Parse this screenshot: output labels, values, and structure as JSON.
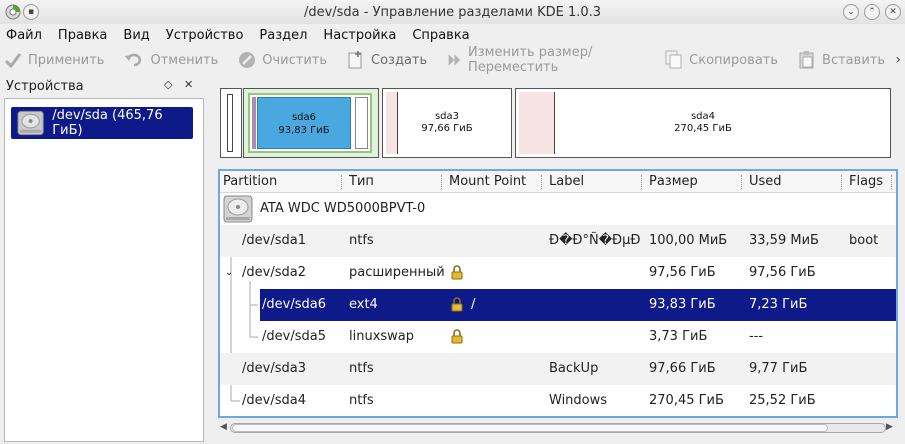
{
  "window": {
    "title": "/dev/sda - Управление разделами KDE 1.0.3"
  },
  "menu": [
    "Файл",
    "Правка",
    "Вид",
    "Устройство",
    "Раздел",
    "Настройка",
    "Справка"
  ],
  "toolbar": {
    "apply": "Применить",
    "undo": "Отменить",
    "clear": "Очистить",
    "create": "Создать",
    "resize": "Изменить размер/Переместить",
    "copy": "Скопировать",
    "paste": "Вставить",
    "more": "›"
  },
  "devices_panel": {
    "title": "Устройства",
    "device_label": "/dev/sda (465,76 ГиБ)"
  },
  "partition_bar": {
    "sda6": {
      "name": "sda6",
      "size": "93,83 ГиБ"
    },
    "sda3": {
      "name": "sda3",
      "size": "97,66 ГиБ"
    },
    "sda4": {
      "name": "sda4",
      "size": "270,45 ГиБ"
    }
  },
  "table": {
    "columns": [
      "Partition",
      "Тип",
      "Mount Point",
      "Label",
      "Размер",
      "Used",
      "Flags"
    ],
    "disk": "ATA WDC WD5000BPVT-0",
    "rows": [
      {
        "partition": "/dev/sda1",
        "type": "ntfs",
        "mount": "",
        "label": "Ð�Ð°Ñ�ÐµÐ·Ð·...",
        "size": "100,00 МиБ",
        "used": "33,59 МиБ",
        "flags": "boot"
      },
      {
        "partition": "/dev/sda2",
        "type": "расширенный",
        "mount": "",
        "label": "",
        "size": "97,56 ГиБ",
        "used": "97,56 ГиБ",
        "flags": ""
      },
      {
        "partition": "/dev/sda6",
        "type": "ext4",
        "mount": "/",
        "label": "",
        "size": "93,83 ГиБ",
        "used": "7,23 ГиБ",
        "flags": ""
      },
      {
        "partition": "/dev/sda5",
        "type": "linuxswap",
        "mount": "",
        "label": "",
        "size": "3,73 ГиБ",
        "used": "---",
        "flags": ""
      },
      {
        "partition": "/dev/sda3",
        "type": "ntfs",
        "mount": "",
        "label": "BackUp",
        "size": "97,66 ГиБ",
        "used": "9,77 ГиБ",
        "flags": ""
      },
      {
        "partition": "/dev/sda4",
        "type": "ntfs",
        "mount": "",
        "label": "Windows",
        "size": "270,45 ГиБ",
        "used": "25,52 ГиБ",
        "flags": ""
      }
    ]
  },
  "colors": {
    "selection": "#0e1a8a",
    "sda6_fill": "#4aa8e0",
    "sda6_frame": "#9bc47c",
    "focus": "#6fa8dc"
  }
}
